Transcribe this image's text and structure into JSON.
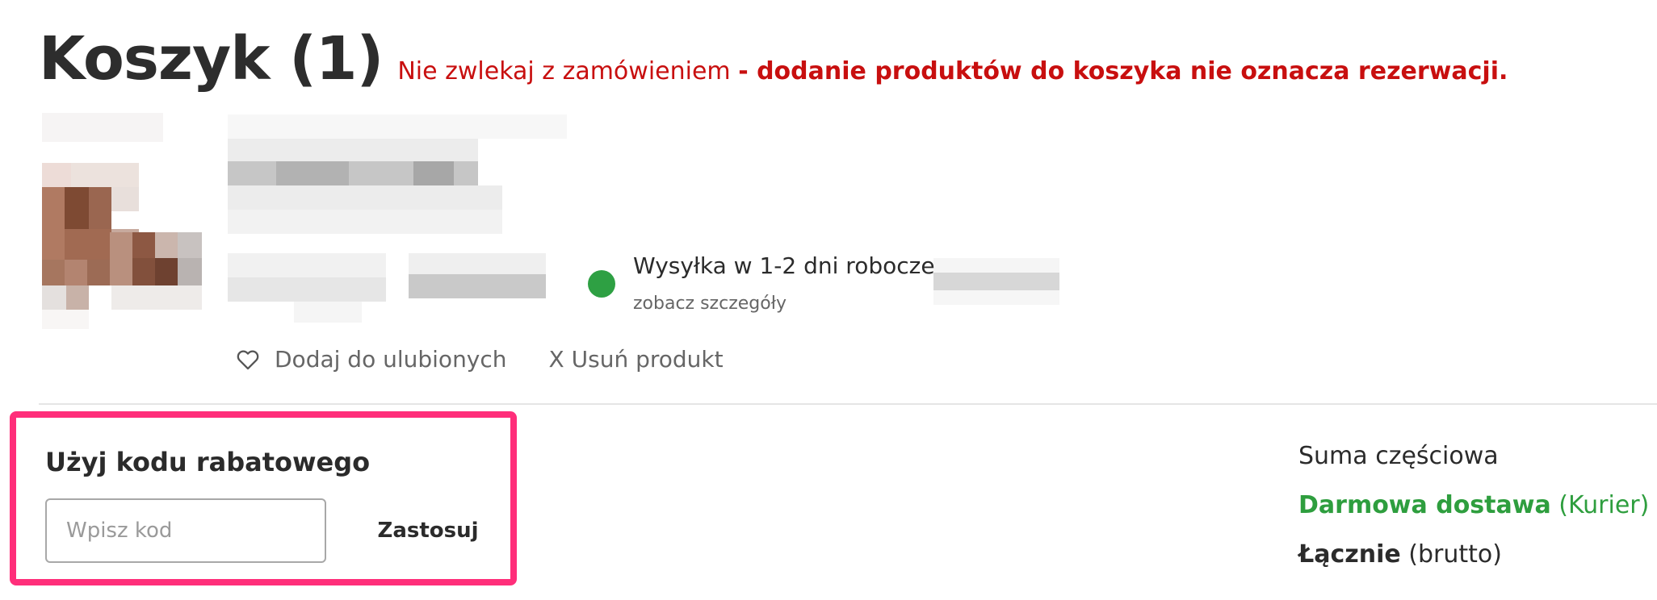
{
  "header": {
    "title": "Koszyk (1)",
    "notice_regular": "Nie zwlekaj z zamówieniem",
    "notice_bold": "- dodanie produktów do koszyka nie oznacza rezerwacji."
  },
  "product": {
    "shipping_status": "Wysyłka w 1-2 dni robocze",
    "shipping_details_link": "zobacz szczegóły",
    "status_color": "#2ea043",
    "add_to_favorites": "Dodaj do ulubionych",
    "remove_product": "X Usuń produkt"
  },
  "discount": {
    "title": "Użyj kodu rabatowego",
    "placeholder": "Wpisz kod",
    "value": "",
    "apply_label": "Zastosuj",
    "highlight_color": "#ff2e7a"
  },
  "summary": {
    "subtotal_label": "Suma częściowa",
    "delivery_label": "Darmowa dostawa",
    "delivery_method": "(Kurier)",
    "total_label": "Łącznie",
    "total_suffix": "(brutto)"
  },
  "colors": {
    "notice_red": "#c80f0f",
    "delivery_green": "#2e9e3e"
  }
}
